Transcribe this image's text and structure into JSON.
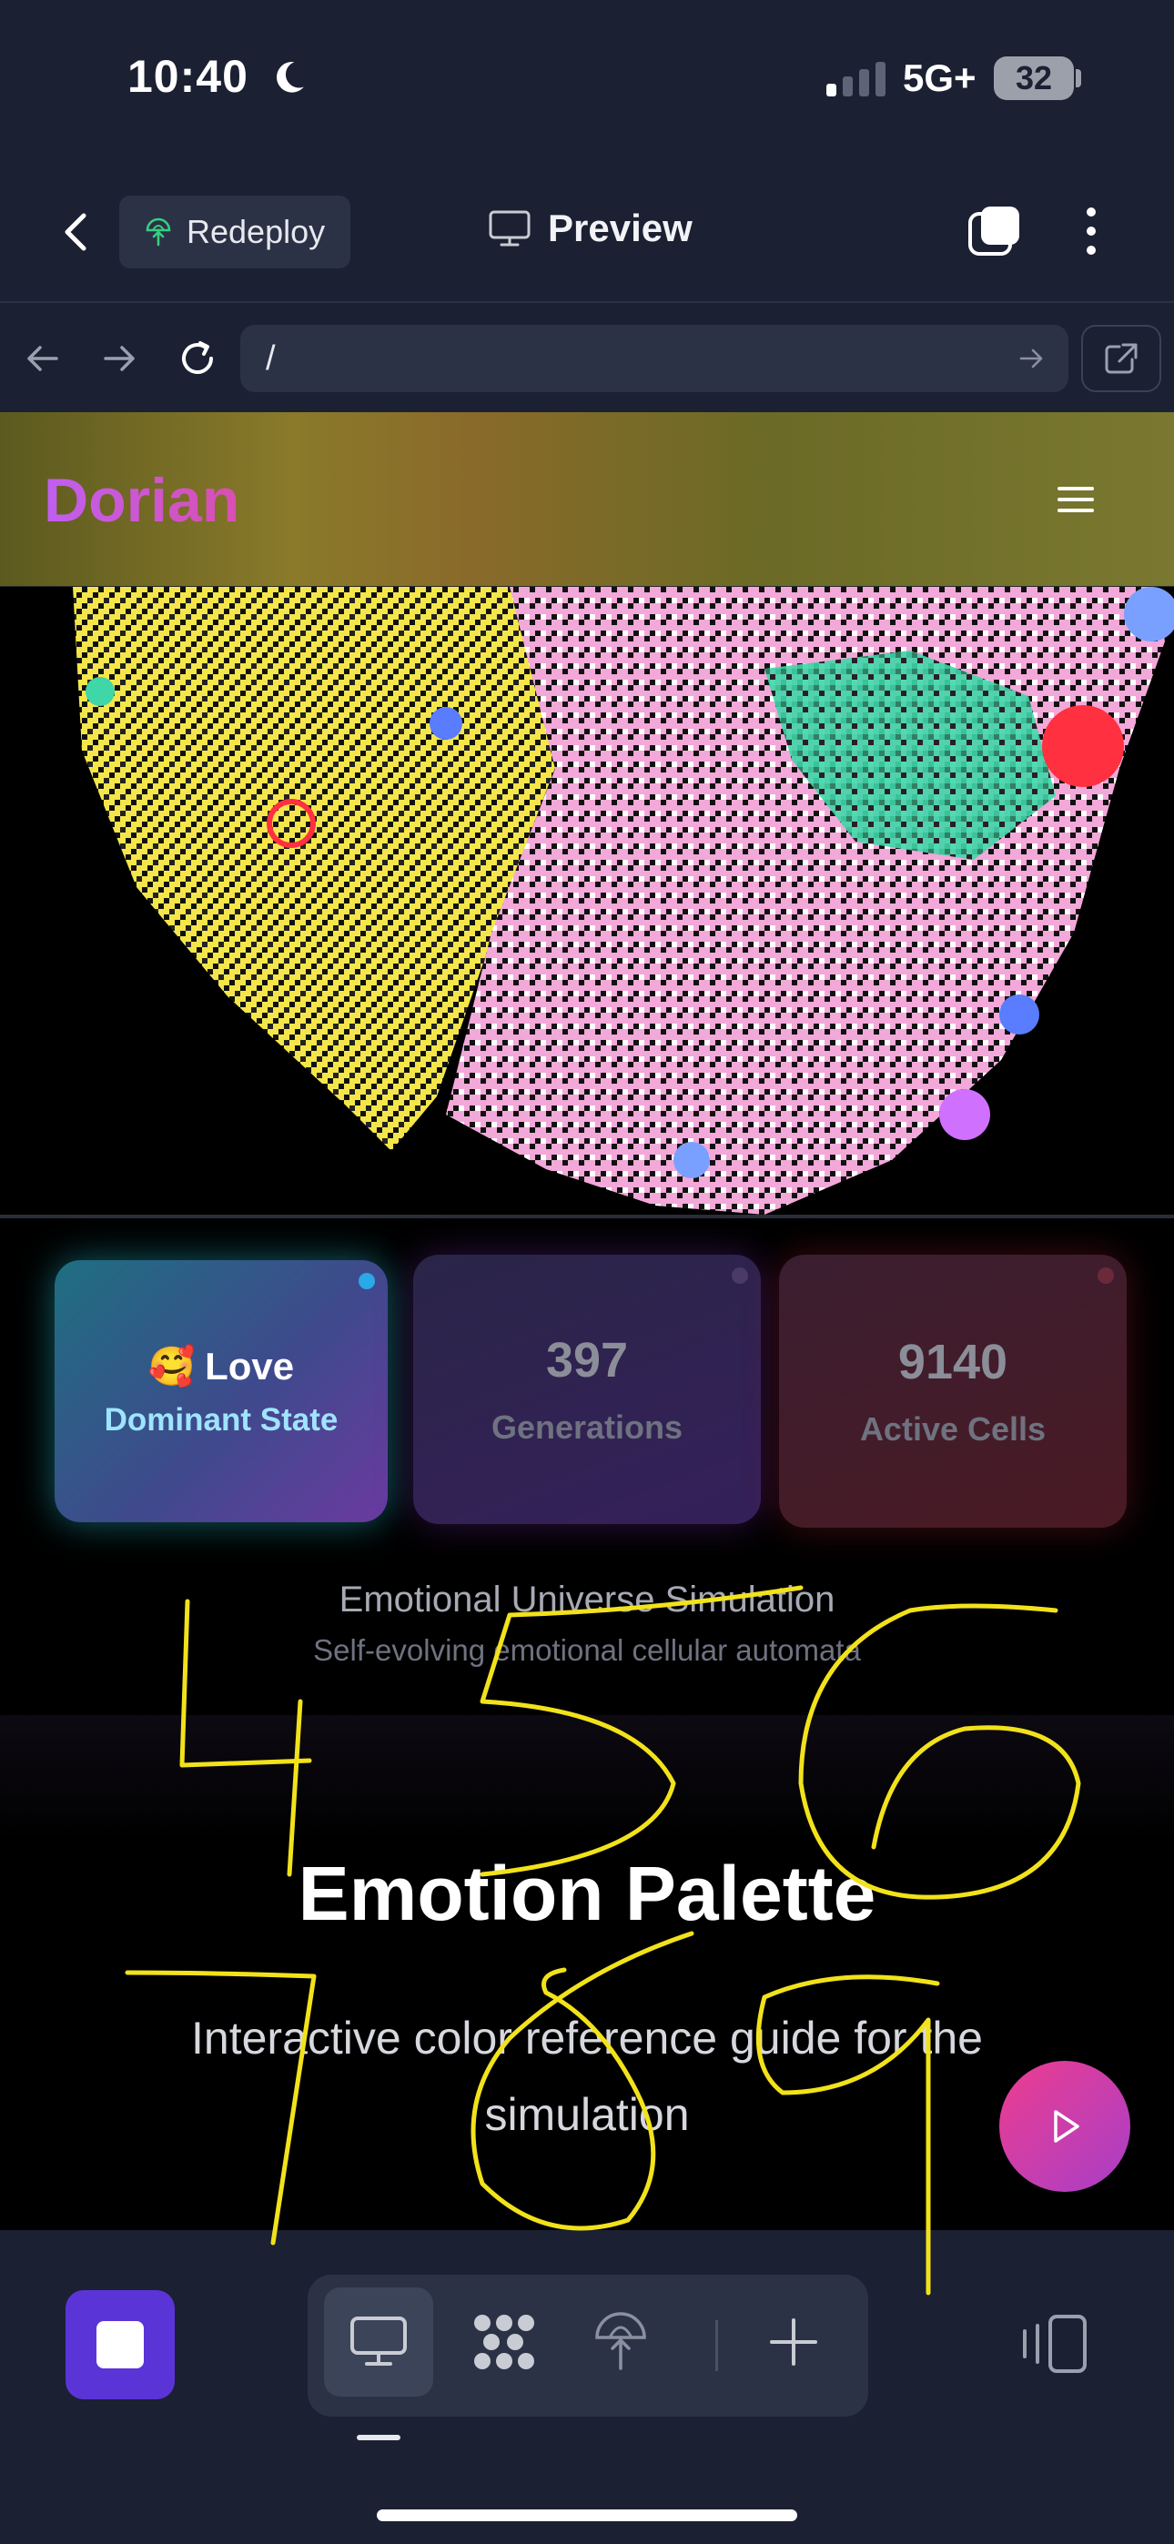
{
  "status_bar": {
    "time": "10:40",
    "network": "5G+",
    "battery": "32",
    "icons": [
      "moon-icon",
      "signal-icon",
      "battery-icon"
    ]
  },
  "toolbar": {
    "redeploy_label": "Redeploy",
    "preview_label": "Preview",
    "icons": [
      "chevron-left-icon",
      "redeploy-icon",
      "monitor-icon",
      "tabs-icon",
      "more-vertical-icon"
    ]
  },
  "url_bar": {
    "url": "/",
    "icons": [
      "arrow-left-icon",
      "arrow-right-icon",
      "reload-icon",
      "go-arrow-icon",
      "external-link-icon"
    ]
  },
  "site": {
    "brand": "Dorian",
    "menu_icon": "hamburger-icon",
    "stats": [
      {
        "emoji": "🥰",
        "value": "Love",
        "label": "Dominant State"
      },
      {
        "value": "397",
        "label": "Generations"
      },
      {
        "value": "9140",
        "label": "Active Cells"
      }
    ],
    "simulation_title": "Emotional Universe Simulation",
    "simulation_subtitle": "Self-evolving emotional cellular automata",
    "palette_title": "Emotion Palette",
    "palette_subtitle": "Interactive color reference guide for the simulation",
    "fab_icon": "play-icon"
  },
  "bottom_bar": {
    "icons": [
      "stop-icon",
      "desktop-icon",
      "apps-grid-icon",
      "deploy-icon",
      "plus-icon",
      "device-layout-icon"
    ]
  },
  "annotation": {
    "handwritten_digits": [
      "4",
      "5",
      "6",
      "7",
      "8",
      "9"
    ],
    "ink_color": "#f2e21a"
  },
  "colors": {
    "chrome_bg": "#1b2032",
    "control_bg": "#2b3246",
    "accent_purple": "#5b34d8",
    "fab_gradient": [
      "#ee3d8f",
      "#a73ec8"
    ],
    "love_card_glow": "#28d2e6"
  }
}
